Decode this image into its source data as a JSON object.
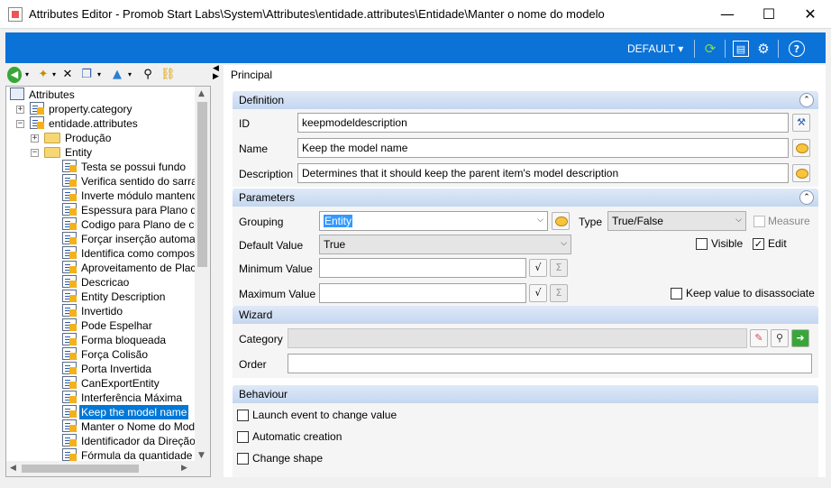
{
  "window": {
    "title": "Attributes Editor - Promob Start Labs\\System\\Attributes\\entidade.attributes\\Entidade\\Manter o nome do modelo",
    "minimize_glyph": "—",
    "maximize_glyph": "☐",
    "close_glyph": "✕"
  },
  "toolbar": {
    "default_label": "DEFAULT ▾",
    "icons": [
      "refresh-icon",
      "layout-icon",
      "settings-icon",
      "help-icon"
    ]
  },
  "left_toolbar": {
    "icons": [
      "back-icon",
      "new-icon",
      "delete-icon",
      "copy-icon",
      "move-up-icon",
      "find-icon",
      "link-icon"
    ]
  },
  "tree": {
    "root": "Attributes",
    "nodes": [
      {
        "label": "property.category",
        "level": 1,
        "type": "attr"
      },
      {
        "label": "entidade.attributes",
        "level": 1,
        "type": "attr"
      },
      {
        "label": "Produção",
        "level": 2,
        "type": "folder"
      },
      {
        "label": "Entity",
        "level": 2,
        "type": "folder"
      },
      {
        "label": "Testa se possui fundo",
        "level": 3,
        "type": "attr"
      },
      {
        "label": "Verifica sentido do sarrafo",
        "level": 3,
        "type": "attr"
      },
      {
        "label": "Inverte módulo mantendo o",
        "level": 3,
        "type": "attr"
      },
      {
        "label": "Espessura para Plano de c",
        "level": 3,
        "type": "attr"
      },
      {
        "label": "Codigo para Plano de corte",
        "level": 3,
        "type": "attr"
      },
      {
        "label": "Forçar inserção automatica",
        "level": 3,
        "type": "attr"
      },
      {
        "label": "Identifica como composição",
        "level": 3,
        "type": "attr"
      },
      {
        "label": "Aproveitamento de Placa",
        "level": 3,
        "type": "attr"
      },
      {
        "label": "Descricao",
        "level": 3,
        "type": "attr"
      },
      {
        "label": "Entity Description",
        "level": 3,
        "type": "attr"
      },
      {
        "label": "Invertido",
        "level": 3,
        "type": "attr"
      },
      {
        "label": "Pode Espelhar",
        "level": 3,
        "type": "attr"
      },
      {
        "label": "Forma bloqueada",
        "level": 3,
        "type": "attr"
      },
      {
        "label": "Força Colisão",
        "level": 3,
        "type": "attr"
      },
      {
        "label": "Porta Invertida",
        "level": 3,
        "type": "attr"
      },
      {
        "label": "CanExportEntity",
        "level": 3,
        "type": "attr"
      },
      {
        "label": "Interferência Máxima",
        "level": 3,
        "type": "attr"
      },
      {
        "label": "Keep the model name",
        "level": 3,
        "type": "attr",
        "selected": true
      },
      {
        "label": "Manter o Nome do Modelo",
        "level": 3,
        "type": "attr"
      },
      {
        "label": "Identificador da Direção d",
        "level": 3,
        "type": "attr"
      },
      {
        "label": "Fórmula da quantidade de",
        "level": 3,
        "type": "attr"
      }
    ]
  },
  "panel": {
    "title": "Principal",
    "definition": {
      "header": "Definition",
      "id_label": "ID",
      "id_value": "keepmodeldescription",
      "name_label": "Name",
      "name_value": "Keep the model name",
      "description_label": "Description",
      "description_value": "Determines that it should keep the parent item's model description"
    },
    "parameters": {
      "header": "Parameters",
      "grouping_label": "Grouping",
      "grouping_value": "Entity",
      "type_label": "Type",
      "type_value": "True/False",
      "measure_label": "Measure",
      "measure_checked": false,
      "default_value_label": "Default Value",
      "default_value": "True",
      "visible_label": "Visible",
      "visible_checked": false,
      "edit_label": "Edit",
      "edit_checked": true,
      "minimum_label": "Minimum Value",
      "minimum_value": "",
      "maximum_label": "Maximum Value",
      "maximum_value": "",
      "keep_value_label": "Keep value to disassociate",
      "keep_value_checked": false,
      "check_glyph": "✓"
    },
    "wizard": {
      "header": "Wizard",
      "category_label": "Category",
      "category_value": "",
      "order_label": "Order",
      "order_value": ""
    },
    "behaviour": {
      "header": "Behaviour",
      "launch_event_label": "Launch event to change value",
      "launch_event_checked": false,
      "automatic_creation_label": "Automatic creation",
      "automatic_creation_checked": false,
      "change_shape_label": "Change shape",
      "change_shape_checked": false
    }
  }
}
